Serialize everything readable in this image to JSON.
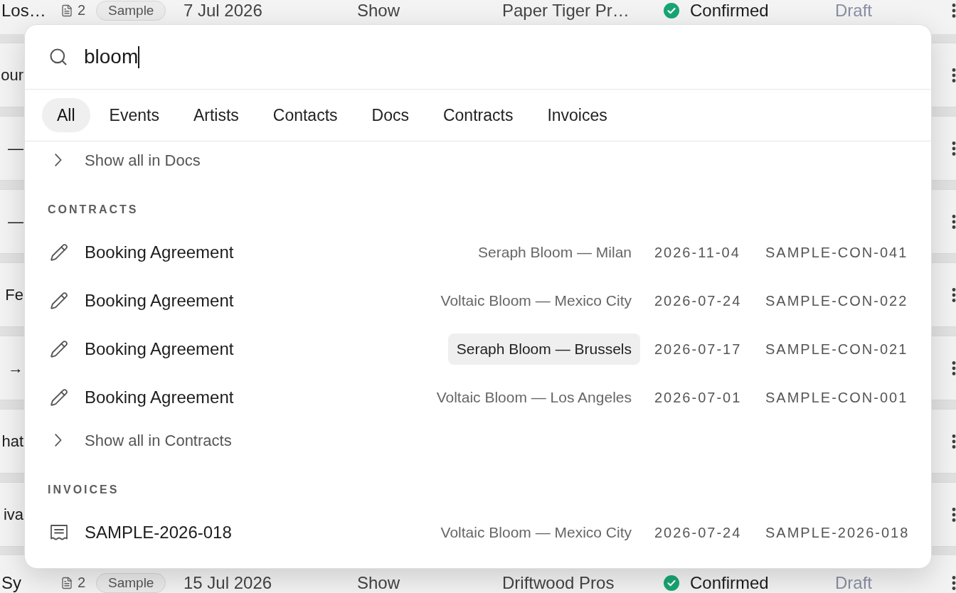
{
  "background_list": {
    "rows": [
      {
        "kind": "full",
        "name": "Los…",
        "documents": "2",
        "tag": "Sample",
        "date": "7 Jul 2026",
        "type": "Show",
        "promoter": "Paper Tiger Pr…",
        "status": "Confirmed",
        "state": "Draft"
      },
      {
        "kind": "edge",
        "name": "our"
      },
      {
        "kind": "edge",
        "name": "—"
      },
      {
        "kind": "edge",
        "name": "—"
      },
      {
        "kind": "edge",
        "name": "Fe"
      },
      {
        "kind": "edge",
        "name": "→"
      },
      {
        "kind": "edge",
        "name": "hat"
      },
      {
        "kind": "edge",
        "name": "iva"
      },
      {
        "kind": "full",
        "name": "Sy",
        "documents": "2",
        "tag": "Sample",
        "date": "15 Jul 2026",
        "type": "Show",
        "promoter": "Driftwood Pros",
        "status": "Confirmed",
        "state": "Draft"
      }
    ]
  },
  "search_dialog": {
    "search": {
      "value": "bloom"
    },
    "tabs": [
      {
        "label": "All",
        "selected": true
      },
      {
        "label": "Events",
        "selected": false
      },
      {
        "label": "Artists",
        "selected": false
      },
      {
        "label": "Contacts",
        "selected": false
      },
      {
        "label": "Docs",
        "selected": false
      },
      {
        "label": "Contracts",
        "selected": false
      },
      {
        "label": "Invoices",
        "selected": false
      }
    ],
    "results": [
      {
        "kind": "show_all",
        "label": "Show all in Docs"
      },
      {
        "kind": "section",
        "label": "CONTRACTS"
      },
      {
        "kind": "contract",
        "title": "Booking Agreement",
        "subtitle": "Seraph Bloom — Milan",
        "date": "2026-11-04",
        "reference": "SAMPLE-CON-041",
        "highlighted": false
      },
      {
        "kind": "contract",
        "title": "Booking Agreement",
        "subtitle": "Voltaic Bloom — Mexico City",
        "date": "2026-07-24",
        "reference": "SAMPLE-CON-022",
        "highlighted": false
      },
      {
        "kind": "contract",
        "title": "Booking Agreement",
        "subtitle": "Seraph Bloom — Brussels",
        "date": "2026-07-17",
        "reference": "SAMPLE-CON-021",
        "highlighted": true
      },
      {
        "kind": "contract",
        "title": "Booking Agreement",
        "subtitle": "Voltaic Bloom — Los Angeles",
        "date": "2026-07-01",
        "reference": "SAMPLE-CON-001",
        "highlighted": false
      },
      {
        "kind": "show_all",
        "label": "Show all in Contracts"
      },
      {
        "kind": "section",
        "label": "INVOICES"
      },
      {
        "kind": "invoice",
        "title": "SAMPLE-2026-018",
        "subtitle": "Voltaic Bloom — Mexico City",
        "date": "2026-07-24",
        "reference": "SAMPLE-2026-018",
        "highlighted": false
      }
    ]
  }
}
